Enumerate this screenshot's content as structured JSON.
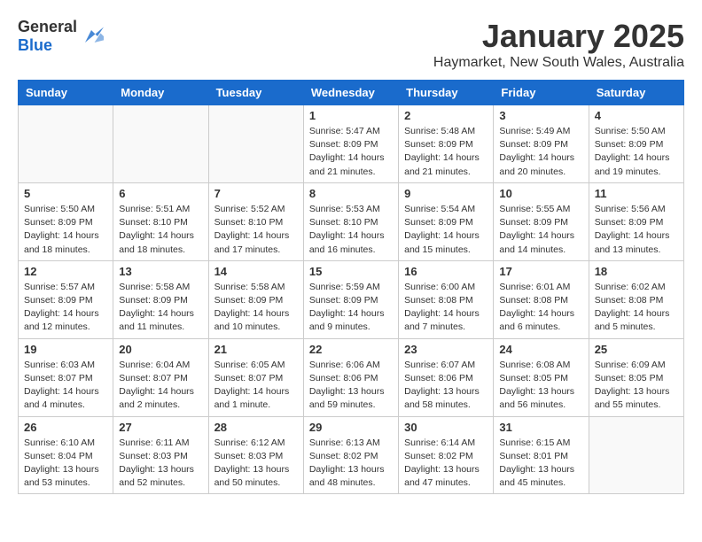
{
  "header": {
    "logo_general": "General",
    "logo_blue": "Blue",
    "month": "January 2025",
    "location": "Haymarket, New South Wales, Australia"
  },
  "weekdays": [
    "Sunday",
    "Monday",
    "Tuesday",
    "Wednesday",
    "Thursday",
    "Friday",
    "Saturday"
  ],
  "weeks": [
    [
      {
        "day": "",
        "info": ""
      },
      {
        "day": "",
        "info": ""
      },
      {
        "day": "",
        "info": ""
      },
      {
        "day": "1",
        "info": "Sunrise: 5:47 AM\nSunset: 8:09 PM\nDaylight: 14 hours\nand 21 minutes."
      },
      {
        "day": "2",
        "info": "Sunrise: 5:48 AM\nSunset: 8:09 PM\nDaylight: 14 hours\nand 21 minutes."
      },
      {
        "day": "3",
        "info": "Sunrise: 5:49 AM\nSunset: 8:09 PM\nDaylight: 14 hours\nand 20 minutes."
      },
      {
        "day": "4",
        "info": "Sunrise: 5:50 AM\nSunset: 8:09 PM\nDaylight: 14 hours\nand 19 minutes."
      }
    ],
    [
      {
        "day": "5",
        "info": "Sunrise: 5:50 AM\nSunset: 8:09 PM\nDaylight: 14 hours\nand 18 minutes."
      },
      {
        "day": "6",
        "info": "Sunrise: 5:51 AM\nSunset: 8:10 PM\nDaylight: 14 hours\nand 18 minutes."
      },
      {
        "day": "7",
        "info": "Sunrise: 5:52 AM\nSunset: 8:10 PM\nDaylight: 14 hours\nand 17 minutes."
      },
      {
        "day": "8",
        "info": "Sunrise: 5:53 AM\nSunset: 8:10 PM\nDaylight: 14 hours\nand 16 minutes."
      },
      {
        "day": "9",
        "info": "Sunrise: 5:54 AM\nSunset: 8:09 PM\nDaylight: 14 hours\nand 15 minutes."
      },
      {
        "day": "10",
        "info": "Sunrise: 5:55 AM\nSunset: 8:09 PM\nDaylight: 14 hours\nand 14 minutes."
      },
      {
        "day": "11",
        "info": "Sunrise: 5:56 AM\nSunset: 8:09 PM\nDaylight: 14 hours\nand 13 minutes."
      }
    ],
    [
      {
        "day": "12",
        "info": "Sunrise: 5:57 AM\nSunset: 8:09 PM\nDaylight: 14 hours\nand 12 minutes."
      },
      {
        "day": "13",
        "info": "Sunrise: 5:58 AM\nSunset: 8:09 PM\nDaylight: 14 hours\nand 11 minutes."
      },
      {
        "day": "14",
        "info": "Sunrise: 5:58 AM\nSunset: 8:09 PM\nDaylight: 14 hours\nand 10 minutes."
      },
      {
        "day": "15",
        "info": "Sunrise: 5:59 AM\nSunset: 8:09 PM\nDaylight: 14 hours\nand 9 minutes."
      },
      {
        "day": "16",
        "info": "Sunrise: 6:00 AM\nSunset: 8:08 PM\nDaylight: 14 hours\nand 7 minutes."
      },
      {
        "day": "17",
        "info": "Sunrise: 6:01 AM\nSunset: 8:08 PM\nDaylight: 14 hours\nand 6 minutes."
      },
      {
        "day": "18",
        "info": "Sunrise: 6:02 AM\nSunset: 8:08 PM\nDaylight: 14 hours\nand 5 minutes."
      }
    ],
    [
      {
        "day": "19",
        "info": "Sunrise: 6:03 AM\nSunset: 8:07 PM\nDaylight: 14 hours\nand 4 minutes."
      },
      {
        "day": "20",
        "info": "Sunrise: 6:04 AM\nSunset: 8:07 PM\nDaylight: 14 hours\nand 2 minutes."
      },
      {
        "day": "21",
        "info": "Sunrise: 6:05 AM\nSunset: 8:07 PM\nDaylight: 14 hours\nand 1 minute."
      },
      {
        "day": "22",
        "info": "Sunrise: 6:06 AM\nSunset: 8:06 PM\nDaylight: 13 hours\nand 59 minutes."
      },
      {
        "day": "23",
        "info": "Sunrise: 6:07 AM\nSunset: 8:06 PM\nDaylight: 13 hours\nand 58 minutes."
      },
      {
        "day": "24",
        "info": "Sunrise: 6:08 AM\nSunset: 8:05 PM\nDaylight: 13 hours\nand 56 minutes."
      },
      {
        "day": "25",
        "info": "Sunrise: 6:09 AM\nSunset: 8:05 PM\nDaylight: 13 hours\nand 55 minutes."
      }
    ],
    [
      {
        "day": "26",
        "info": "Sunrise: 6:10 AM\nSunset: 8:04 PM\nDaylight: 13 hours\nand 53 minutes."
      },
      {
        "day": "27",
        "info": "Sunrise: 6:11 AM\nSunset: 8:03 PM\nDaylight: 13 hours\nand 52 minutes."
      },
      {
        "day": "28",
        "info": "Sunrise: 6:12 AM\nSunset: 8:03 PM\nDaylight: 13 hours\nand 50 minutes."
      },
      {
        "day": "29",
        "info": "Sunrise: 6:13 AM\nSunset: 8:02 PM\nDaylight: 13 hours\nand 48 minutes."
      },
      {
        "day": "30",
        "info": "Sunrise: 6:14 AM\nSunset: 8:02 PM\nDaylight: 13 hours\nand 47 minutes."
      },
      {
        "day": "31",
        "info": "Sunrise: 6:15 AM\nSunset: 8:01 PM\nDaylight: 13 hours\nand 45 minutes."
      },
      {
        "day": "",
        "info": ""
      }
    ]
  ]
}
